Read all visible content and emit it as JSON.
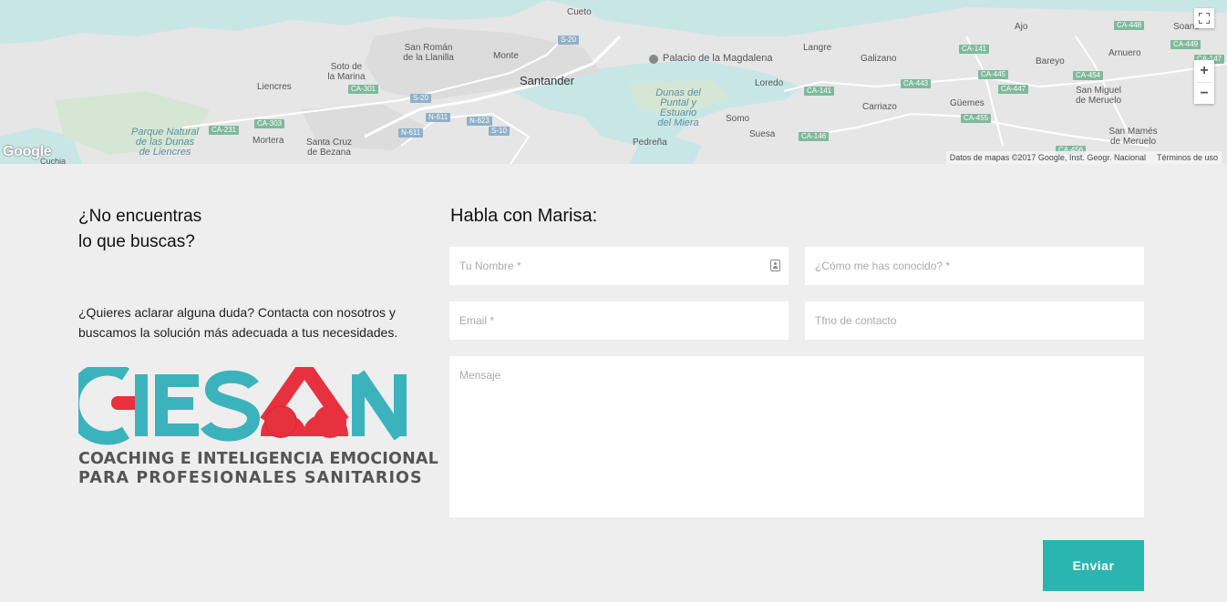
{
  "map": {
    "labels": {
      "cueto": "Cueto",
      "san_roman": "San Román\nde la Llanilla",
      "monte": "Monte",
      "santander": "Santander",
      "palacio": "Palacio de la Magdalena",
      "sota": "Soto de\nla Marina",
      "liencres": "Liencres",
      "parque": "Parque Natural\nde las Dunas\nde Liencres",
      "mortera": "Mortera",
      "santa_cruz": "Santa Cruz\nde Bezana",
      "dunas": "Dunas del\nPuntal y\nEstuario\ndel Miera",
      "somo": "Somo",
      "loredo": "Loredo",
      "suesa": "Suesa",
      "pedrena": "Pedreña",
      "langre": "Langre",
      "galizano": "Galizano",
      "carriazo": "Carriazo",
      "guemes": "Güemes",
      "ajo": "Ajo",
      "bareyo": "Bareyo",
      "arnuero": "Arnuero",
      "san_miguel": "San Miguel\nde Meruelo",
      "san_mames": "San Mamés\nde Meruelo",
      "soano": "Soano",
      "cuchia": "Cuchia"
    },
    "shields": {
      "s20a": "S-20",
      "s20b": "S-20",
      "ca301": "CA-301",
      "ca303": "CA-303",
      "ca231": "CA-231",
      "n611a": "N-611",
      "n611b": "N-611",
      "n623": "N-623",
      "s10": "S-10",
      "ca141a": "CA-141",
      "ca141b": "CA-141",
      "ca146": "CA-146",
      "ca443": "CA-443",
      "ca445": "CA-445",
      "ca447": "CA-447",
      "ca454": "CA-454",
      "ca455": "CA-455",
      "ca448": "CA-448",
      "ca449": "CA-449",
      "ca147": "CA-147",
      "ca456": "CA-456"
    },
    "google_logo": "Google",
    "attribution": "Datos de mapas ©2017 Google, Inst. Geogr. Nacional",
    "terms": "Términos de uso",
    "zoom_in": "+",
    "zoom_out": "−"
  },
  "left": {
    "heading_line1": "¿No encuentras",
    "heading_line2": "lo que buscas?",
    "intro_line1": "¿Quieres aclarar alguna duda? Contacta con nosotros y",
    "intro_line2": "buscamos la solución más adecuada a tus necesidades.",
    "logo_tagline1": "COACHING E INTELIGENCIA EMOCIONAL",
    "logo_tagline2": "PARA PROFESIONALES SANITARIOS",
    "logo_colors": {
      "teal": "#3bb3bd",
      "red": "#e8313f"
    }
  },
  "form": {
    "title": "Habla con Marisa:",
    "name_placeholder": "Tu Nombre *",
    "how_placeholder": "¿Cómo me has conocido? *",
    "email_placeholder": "Email *",
    "phone_placeholder": "Tfno de contacto",
    "message_placeholder": "Mensaje",
    "submit_label": "Enviar",
    "accent_color": "#2bb5b0"
  }
}
